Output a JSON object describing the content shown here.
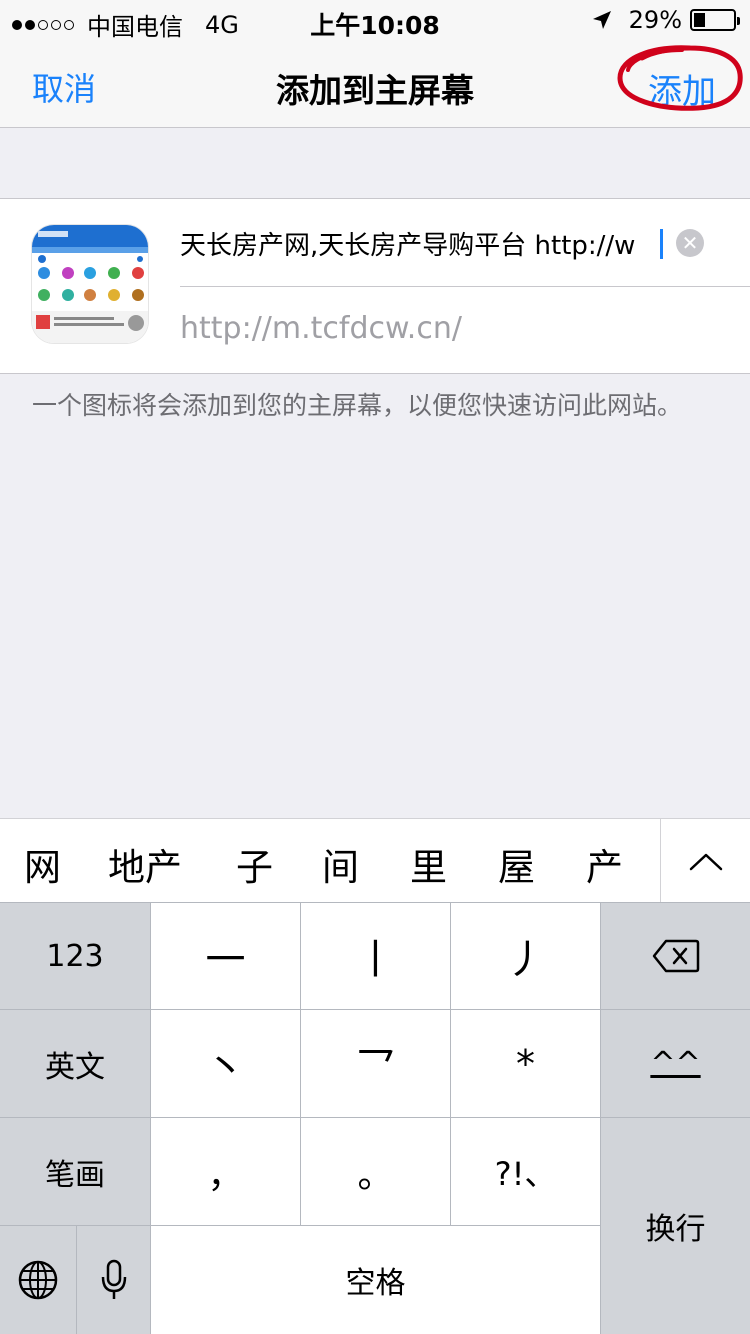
{
  "status_bar": {
    "carrier": "中国电信",
    "network": "4G",
    "time": "上午10:08",
    "battery_percent": "29%",
    "battery_level": 0.29,
    "signal_bars_filled": 2,
    "signal_bars_total": 5
  },
  "nav": {
    "cancel_label": "取消",
    "title": "添加到主屏幕",
    "add_label": "添加",
    "annotation_color": "#d0021b"
  },
  "form": {
    "title_value": "天长房产网,天长房产导购平台 http://w",
    "url": "http://m.tcfdcw.cn/"
  },
  "hint": "一个图标将会添加到您的主屏幕，以便您快速访问此网站。",
  "candidates": [
    "网",
    "地产",
    "子",
    "间",
    "里",
    "屋",
    "产"
  ],
  "keyboard": {
    "numbers_label": "123",
    "english_label": "英文",
    "strokes_label": "笔画",
    "stroke_keys": [
      "一",
      "丨",
      "丿",
      "丶",
      "乛",
      "*"
    ],
    "punctuation_keys": [
      "，",
      "。",
      "?!、"
    ],
    "emoticon_label": "^^",
    "space_label": "空格",
    "return_label": "换行"
  },
  "colors": {
    "accent": "#1a82fb",
    "background": "#efeff4",
    "keyboard_bg": "#b4b8bf",
    "function_key": "#d1d4d9"
  }
}
